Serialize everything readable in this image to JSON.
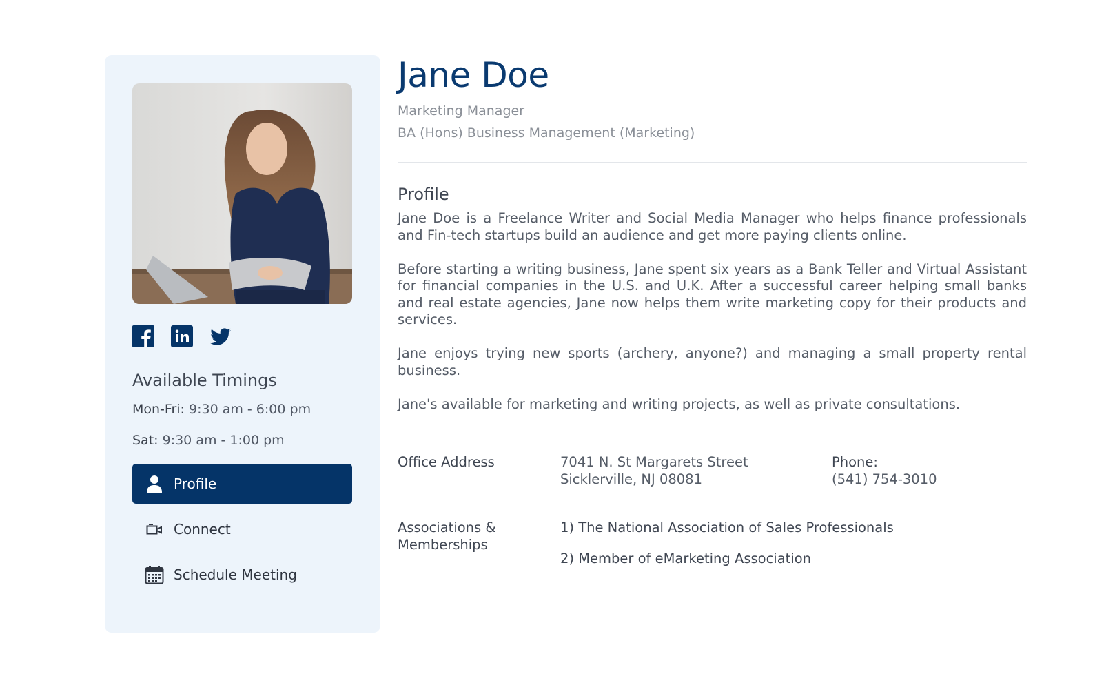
{
  "sidebar": {
    "socials": [
      "facebook-icon",
      "linkedin-icon",
      "twitter-icon"
    ],
    "timings_title": "Available Timings",
    "timings": [
      {
        "day": "Mon-Fri:",
        "hours": " 9:30 am - 6:00 pm"
      },
      {
        "day": "Sat:",
        "hours": " 9:30 am - 1:00 pm"
      }
    ],
    "nav": [
      {
        "label": "Profile",
        "icon": "user-icon",
        "active": true
      },
      {
        "label": "Connect",
        "icon": "video-camera-icon",
        "active": false
      },
      {
        "label": "Schedule Meeting",
        "icon": "calendar-icon",
        "active": false
      }
    ]
  },
  "header": {
    "name": "Jane Doe",
    "title": "Marketing Manager",
    "degree": "BA (Hons) Business Management (Marketing)"
  },
  "profile": {
    "title": "Profile",
    "paragraphs": [
      "Jane Doe is a Freelance Writer and Social Media Manager who helps finance professionals and Fin-tech startups build an audience and get more paying clients online.",
      "Before starting a writing business, Jane spent six years as a Bank Teller and Virtual Assistant for financial companies in the U.S. and U.K. After a successful career helping small banks and real estate agencies, Jane now helps them write marketing copy for their products and services.",
      "Jane enjoys trying new sports (archery, anyone?) and managing a small property rental business.",
      "Jane's available for marketing and writing projects, as well as private consultations."
    ]
  },
  "contact": {
    "office_label": "Office Address",
    "address_line1": "7041 N. St Margarets Street",
    "address_line2": "Sicklerville, NJ 08081",
    "phone_label": "Phone:",
    "phone": "(541) 754-3010"
  },
  "associations": {
    "label_line1": "Associations &",
    "label_line2": "Memberships",
    "items": [
      "1) The National Association of Sales Professionals",
      "2) Member of eMarketing Association"
    ]
  },
  "colors": {
    "accent": "#053468",
    "name": "#0a3a70",
    "sidebar_bg": "#edf4fb"
  }
}
